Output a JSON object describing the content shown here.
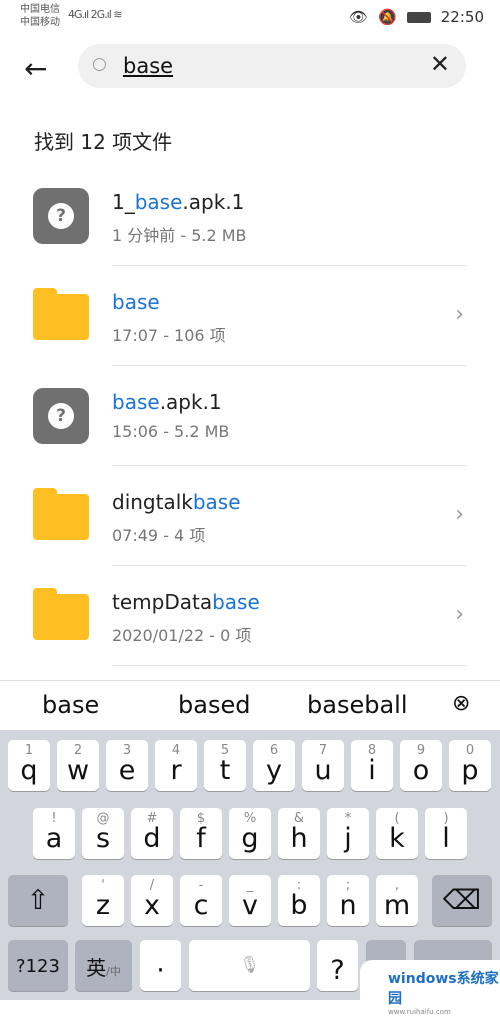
{
  "status": {
    "carrier1": "中国电信",
    "carrier2": "中国移动",
    "sig1": "4G",
    "sig2": "2G",
    "time": "22:50"
  },
  "search": {
    "value": "base"
  },
  "result_count": "找到 12 项文件",
  "files": [
    {
      "pre": "1_",
      "hl": "base",
      "post": ".apk.1",
      "meta": "1 分钟前 - 5.2 MB",
      "type": "unknown"
    },
    {
      "pre": "",
      "hl": "base",
      "post": "",
      "meta": "17:07 - 106 项",
      "type": "folder"
    },
    {
      "pre": "",
      "hl": "base",
      "post": ".apk.1",
      "meta": "15:06 - 5.2 MB",
      "type": "unknown"
    },
    {
      "pre": "dingtalk",
      "hl": "base",
      "post": "",
      "meta": "07:49 - 4 项",
      "type": "folder"
    },
    {
      "pre": "tempData",
      "hl": "base",
      "post": "",
      "meta": "2020/01/22 - 0 项",
      "type": "folder"
    }
  ],
  "suggestions": [
    "base",
    "based",
    "baseball"
  ],
  "keyboard": {
    "row1": [
      [
        "q",
        "1"
      ],
      [
        "w",
        "2"
      ],
      [
        "e",
        "3"
      ],
      [
        "r",
        "4"
      ],
      [
        "t",
        "5"
      ],
      [
        "y",
        "6"
      ],
      [
        "u",
        "7"
      ],
      [
        "i",
        "8"
      ],
      [
        "o",
        "9"
      ],
      [
        "p",
        "0"
      ]
    ],
    "row2": [
      [
        "a",
        "!"
      ],
      [
        "s",
        "@"
      ],
      [
        "d",
        "#"
      ],
      [
        "f",
        "$"
      ],
      [
        "g",
        "%"
      ],
      [
        "h",
        "&"
      ],
      [
        "j",
        "*"
      ],
      [
        "k",
        "("
      ],
      [
        "l",
        ")"
      ]
    ],
    "row3": [
      [
        "z",
        "'"
      ],
      [
        "x",
        "/"
      ],
      [
        "c",
        "-"
      ],
      [
        "v",
        "_"
      ],
      [
        "b",
        ":"
      ],
      [
        "n",
        ";"
      ],
      [
        "m",
        ","
      ]
    ],
    "num": "?123",
    "lang": "英",
    "lang_sub": "/中",
    "dot": "·",
    "q": "?"
  },
  "watermark": {
    "text": "windows系统家园",
    "url": "www.ruihaifu.com"
  },
  "colors": {
    "highlight": "#1a73d9",
    "folder": "#ffbf22"
  }
}
